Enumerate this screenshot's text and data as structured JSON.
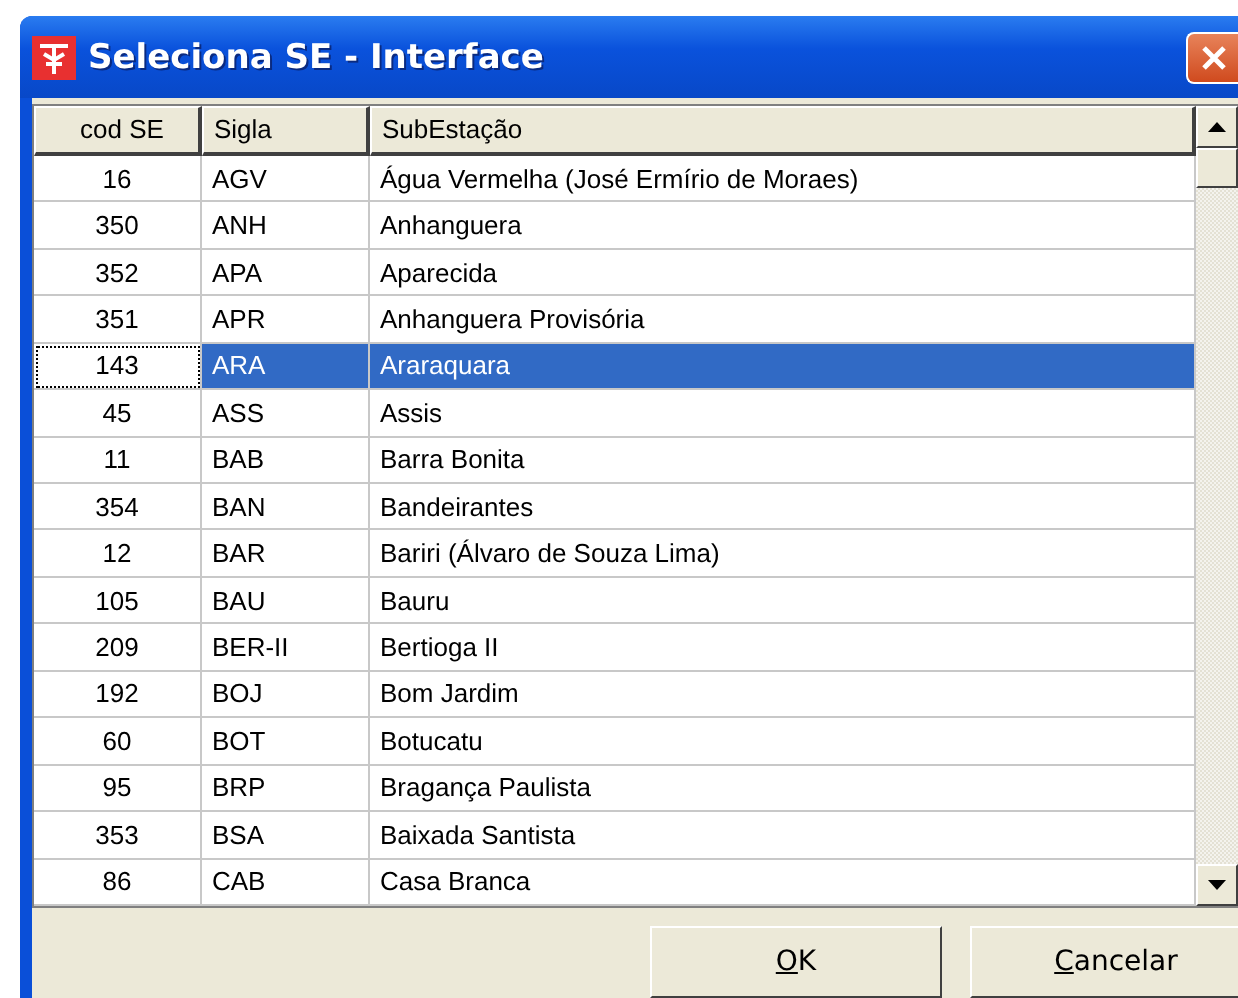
{
  "window": {
    "title": "Seleciona SE - Interface"
  },
  "table": {
    "columns": [
      "cod SE",
      "Sigla",
      "SubEstação"
    ],
    "rows": [
      {
        "cells": [
          "16",
          "AGV",
          "Água Vermelha (José Ermírio de Moraes)"
        ],
        "selected": false
      },
      {
        "cells": [
          "350",
          "ANH",
          "Anhanguera"
        ],
        "selected": false
      },
      {
        "cells": [
          "352",
          "APA",
          "Aparecida"
        ],
        "selected": false
      },
      {
        "cells": [
          "351",
          "APR",
          "Anhanguera Provisória"
        ],
        "selected": false
      },
      {
        "cells": [
          "143",
          "ARA",
          "Araraquara"
        ],
        "selected": true
      },
      {
        "cells": [
          "45",
          "ASS",
          "Assis"
        ],
        "selected": false
      },
      {
        "cells": [
          "11",
          "BAB",
          "Barra Bonita"
        ],
        "selected": false
      },
      {
        "cells": [
          "354",
          "BAN",
          "Bandeirantes"
        ],
        "selected": false
      },
      {
        "cells": [
          "12",
          "BAR",
          "Bariri (Álvaro de Souza Lima)"
        ],
        "selected": false
      },
      {
        "cells": [
          "105",
          "BAU",
          "Bauru"
        ],
        "selected": false
      },
      {
        "cells": [
          "209",
          "BER-II",
          "Bertioga II"
        ],
        "selected": false
      },
      {
        "cells": [
          "192",
          "BOJ",
          "Bom Jardim"
        ],
        "selected": false
      },
      {
        "cells": [
          "60",
          "BOT",
          "Botucatu"
        ],
        "selected": false
      },
      {
        "cells": [
          "95",
          "BRP",
          "Bragança Paulista"
        ],
        "selected": false
      },
      {
        "cells": [
          "353",
          "BSA",
          "Baixada Santista"
        ],
        "selected": false
      },
      {
        "cells": [
          "86",
          "CAB",
          "Casa Branca"
        ],
        "selected": false
      }
    ]
  },
  "buttons": [
    "OK",
    "Cancelar"
  ]
}
